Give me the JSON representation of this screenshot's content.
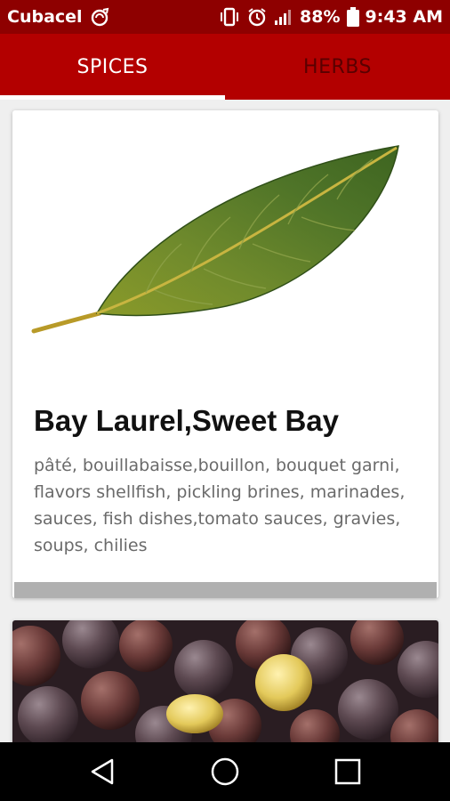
{
  "status_bar": {
    "carrier": "Cubacel",
    "battery": "88%",
    "time": "9:43 AM",
    "icons": [
      "carrier-badge-icon",
      "vibrate-icon",
      "alarm-icon",
      "signal-icon",
      "battery-icon"
    ]
  },
  "tabs": [
    {
      "label": "SPICES",
      "selected": true
    },
    {
      "label": "HERBS",
      "selected": false
    }
  ],
  "cards": [
    {
      "title": "Bay Laurel,Sweet Bay",
      "description": "pâté, bouillabaisse,bouillon, bouquet garni, flavors shellfish, pickling brines, marinades, sauces, fish dishes,tomato sauces, gravies, soups, chilies",
      "image": "bay-leaf"
    },
    {
      "image": "mustard-seeds"
    }
  ],
  "nav": [
    "back-icon",
    "home-icon",
    "recents-icon"
  ],
  "colors": {
    "status_bar": "#8e0000",
    "app_bar": "#b30000",
    "tab_active": "#ffffff",
    "tab_inactive": "#5a0000"
  }
}
